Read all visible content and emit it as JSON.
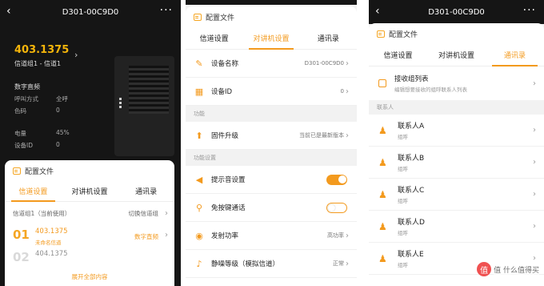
{
  "panel1": {
    "device_title": "D301-00C9D0",
    "frequency": "403.1375",
    "channel_name": "信道组1 - 信道1",
    "mode_label": "数字直频",
    "call_mode_label": "呼叫方式",
    "call_mode_value": "全呼",
    "color_code_label": "色码",
    "color_code_value": "0",
    "battery_label": "电量",
    "battery_value": "45%",
    "device_id_label": "设备ID",
    "device_id_value": "0",
    "sheet_title": "配置文件",
    "tabs": [
      "信道设置",
      "对讲机设置",
      "通讯录"
    ],
    "group_label": "信道组1（当前使用）",
    "switch_label": "切换信道组",
    "channels": [
      {
        "num": "01",
        "freq": "403.1375",
        "name": "未命名信道",
        "type": "数字直频"
      },
      {
        "num": "02",
        "freq": "404.1375",
        "name": "",
        "type": ""
      }
    ],
    "expand_label": "展开全部内容"
  },
  "panel2": {
    "sheet_title": "配置文件",
    "tabs": [
      "信道设置",
      "对讲机设置",
      "通讯录"
    ],
    "rows1": [
      {
        "icon": "✎",
        "label": "设备名称",
        "value": "D301-00C9D0"
      },
      {
        "icon": "▦",
        "label": "设备ID",
        "value": "0"
      }
    ],
    "section_func": "功能",
    "rows2": [
      {
        "icon": "⬆",
        "label": "固件升级",
        "value": "当前已是最新版本"
      }
    ],
    "section_settings": "功能设置",
    "rows3": [
      {
        "icon": "◀",
        "label": "提示音设置",
        "value": "",
        "toggle": "on"
      },
      {
        "icon": "⚲",
        "label": "免按键通话",
        "value": "",
        "toggle": "off"
      },
      {
        "icon": "◉",
        "label": "发射功率",
        "value": "高功率"
      },
      {
        "icon": "♪",
        "label": "静噪等级（模拟信道）",
        "value": "正常"
      }
    ]
  },
  "panel3": {
    "device_title": "D301-00C9D0",
    "sheet_title": "配置文件",
    "tabs": [
      "信道设置",
      "对讲机设置",
      "通讯录"
    ],
    "receive_title": "接收组列表",
    "receive_sub": "编辑想要接收的组呼联系人列表",
    "section_contacts": "联系人",
    "contacts": [
      {
        "name": "联系人A",
        "sub": "组呼"
      },
      {
        "name": "联系人B",
        "sub": "组呼"
      },
      {
        "name": "联系人C",
        "sub": "组呼"
      },
      {
        "name": "联系人D",
        "sub": "组呼"
      },
      {
        "name": "联系人E",
        "sub": "组呼"
      }
    ]
  },
  "watermark": "值 什么值得买",
  "colors": {
    "accent": "#f39a1e",
    "dark": "#151515"
  }
}
